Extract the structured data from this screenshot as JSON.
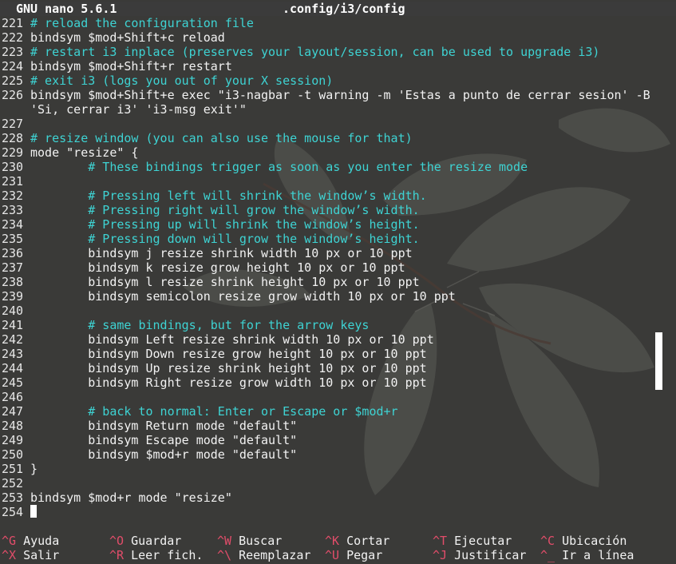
{
  "titlebar": {
    "app": "GNU nano 5.6.1",
    "file": ".config/i3/config"
  },
  "editor": {
    "lines": [
      {
        "n": "221",
        "text": "# reload the configuration file",
        "comment": true
      },
      {
        "n": "222",
        "text": "bindsym $mod+Shift+c reload",
        "comment": false
      },
      {
        "n": "223",
        "text": "# restart i3 inplace (preserves your layout/session, can be used to upgrade i3)",
        "comment": true
      },
      {
        "n": "224",
        "text": "bindsym $mod+Shift+r restart",
        "comment": false
      },
      {
        "n": "225",
        "text": "# exit i3 (logs you out of your X session)",
        "comment": true
      },
      {
        "n": "226",
        "text": "bindsym $mod+Shift+e exec \"i3-nagbar -t warning -m 'Estas a punto de cerrar sesion' -B",
        "comment": false
      },
      {
        "n": "",
        "text": "'Si, cerrar i3' 'i3-msg exit'\"",
        "comment": false
      },
      {
        "n": "227",
        "text": "",
        "comment": false
      },
      {
        "n": "228",
        "text": "# resize window (you can also use the mouse for that)",
        "comment": true
      },
      {
        "n": "229",
        "text": "mode \"resize\" {",
        "comment": false
      },
      {
        "n": "230",
        "text": "        # These bindings trigger as soon as you enter the resize mode",
        "comment": true
      },
      {
        "n": "231",
        "text": "",
        "comment": false
      },
      {
        "n": "232",
        "text": "        # Pressing left will shrink the window’s width.",
        "comment": true
      },
      {
        "n": "233",
        "text": "        # Pressing right will grow the window’s width.",
        "comment": true
      },
      {
        "n": "234",
        "text": "        # Pressing up will shrink the window’s height.",
        "comment": true
      },
      {
        "n": "235",
        "text": "        # Pressing down will grow the window’s height.",
        "comment": true
      },
      {
        "n": "236",
        "text": "        bindsym j resize shrink width 10 px or 10 ppt",
        "comment": false
      },
      {
        "n": "237",
        "text": "        bindsym k resize grow height 10 px or 10 ppt",
        "comment": false
      },
      {
        "n": "238",
        "text": "        bindsym l resize shrink height 10 px or 10 ppt",
        "comment": false
      },
      {
        "n": "239",
        "text": "        bindsym semicolon resize grow width 10 px or 10 ppt",
        "comment": false
      },
      {
        "n": "240",
        "text": "",
        "comment": false
      },
      {
        "n": "241",
        "text": "        # same bindings, but for the arrow keys",
        "comment": true
      },
      {
        "n": "242",
        "text": "        bindsym Left resize shrink width 10 px or 10 ppt",
        "comment": false
      },
      {
        "n": "243",
        "text": "        bindsym Down resize grow height 10 px or 10 ppt",
        "comment": false
      },
      {
        "n": "244",
        "text": "        bindsym Up resize shrink height 10 px or 10 ppt",
        "comment": false
      },
      {
        "n": "245",
        "text": "        bindsym Right resize grow width 10 px or 10 ppt",
        "comment": false
      },
      {
        "n": "246",
        "text": "",
        "comment": false
      },
      {
        "n": "247",
        "text": "        # back to normal: Enter or Escape or $mod+r",
        "comment": true
      },
      {
        "n": "248",
        "text": "        bindsym Return mode \"default\"",
        "comment": false
      },
      {
        "n": "249",
        "text": "        bindsym Escape mode \"default\"",
        "comment": false
      },
      {
        "n": "250",
        "text": "        bindsym $mod+r mode \"default\"",
        "comment": false
      },
      {
        "n": "251",
        "text": "}",
        "comment": false
      },
      {
        "n": "252",
        "text": "",
        "comment": false
      },
      {
        "n": "253",
        "text": "bindsym $mod+r mode \"resize\"",
        "comment": false
      },
      {
        "n": "254",
        "text": "",
        "comment": false,
        "cursor": true
      }
    ]
  },
  "shortcuts": [
    [
      {
        "key": "^G",
        "label": "Ayuda"
      },
      {
        "key": "^O",
        "label": "Guardar"
      },
      {
        "key": "^W",
        "label": "Buscar"
      },
      {
        "key": "^K",
        "label": "Cortar"
      },
      {
        "key": "^T",
        "label": "Ejecutar"
      },
      {
        "key": "^C",
        "label": "Ubicación"
      }
    ],
    [
      {
        "key": "^X",
        "label": "Salir"
      },
      {
        "key": "^R",
        "label": "Leer fich."
      },
      {
        "key": "^\\",
        "label": "Reemplazar"
      },
      {
        "key": "^U",
        "label": "Pegar"
      },
      {
        "key": "^J",
        "label": "Justificar"
      },
      {
        "key": "^_",
        "label": "Ir a línea"
      }
    ]
  ],
  "colors": {
    "comment": "#3ed3d3",
    "shortcut_key": "#e24d6a",
    "background": "#3a3a38"
  },
  "decor": {
    "background_image": "ginkgo-leaves-wallpaper"
  }
}
